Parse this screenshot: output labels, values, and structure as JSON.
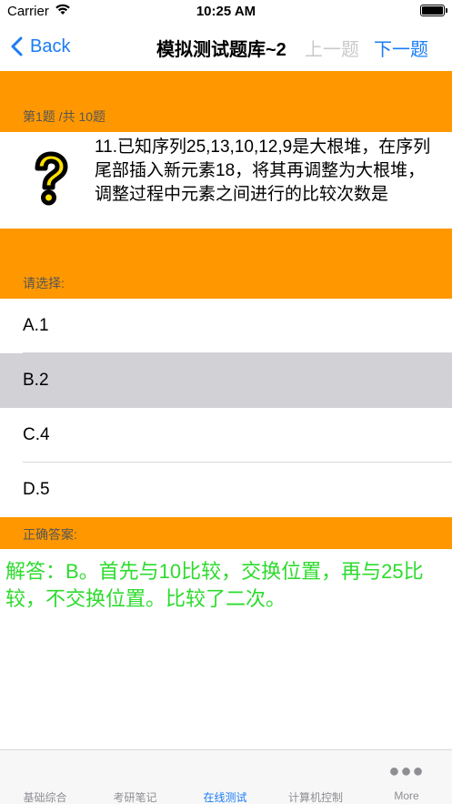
{
  "status": {
    "carrier": "Carrier",
    "time": "10:25 AM"
  },
  "nav": {
    "back_label": "Back",
    "title": "模拟测试题库~2",
    "prev_label": "上一题",
    "next_label": "下一题"
  },
  "question": {
    "counter": "第1题 /共 10题",
    "text": "11.已知序列25,13,10,12,9是大根堆，在序列尾部插入新元素18，将其再调整为大根堆，调整过程中元素之间进行的比较次数是",
    "icon": "question-mark-icon"
  },
  "choices": {
    "header": "请选择:",
    "options": [
      {
        "label": "A.1",
        "selected": false
      },
      {
        "label": "B.2",
        "selected": true
      },
      {
        "label": "C.4",
        "selected": false
      },
      {
        "label": "D.5",
        "selected": false
      }
    ]
  },
  "answer": {
    "header": "正确答案:",
    "text": "解答：B。首先与10比较，交换位置，再与25比较，不交换位置。比较了二次。"
  },
  "tabs": [
    {
      "label": "基础综合",
      "active": false
    },
    {
      "label": "考研笔记",
      "active": false
    },
    {
      "label": "在线测试",
      "active": true
    },
    {
      "label": "计算机控制",
      "active": false
    },
    {
      "label": "More",
      "active": false,
      "icon": "more-dots-icon"
    }
  ],
  "colors": {
    "accent": "#1a7cf6",
    "band": "#ff9800",
    "answer": "#2ddb2d",
    "selected_row": "#d1d1d6"
  }
}
